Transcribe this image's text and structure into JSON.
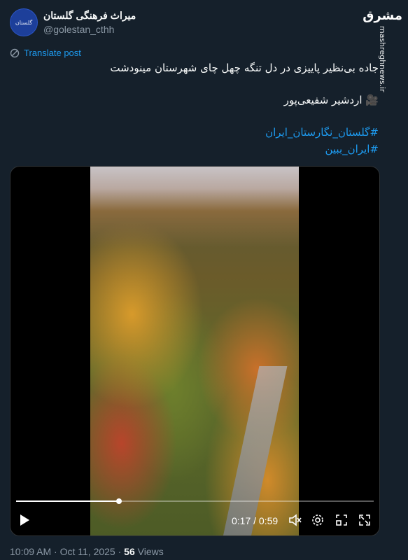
{
  "account": {
    "display_name": "میراث فرهنگی گلستان",
    "handle": "@golestan_cthh",
    "avatar_text": "گلستان"
  },
  "watermark": {
    "logo": "مشرق",
    "site": "mashreghnews.ir"
  },
  "translate_label": "Translate post",
  "tweet": {
    "line1": "جاده بی‌نظیر پاییزی در دل تنگه چهل چای شهرستان مینودشت",
    "credit_icon": "🎥",
    "credit": "اردشیر شفیعی‌پور",
    "hashtag1": "#گلستان_نگارستان_ایران",
    "hashtag2": "#ایران_ببین"
  },
  "video": {
    "current_time": "0:17",
    "duration": "0:59",
    "time_display": "0:17 / 0:59",
    "progress": 0.288
  },
  "footer": {
    "timestamp": "10:09 AM · Oct 11, 2025 · ",
    "views_count": "56",
    "views_label": " Views"
  },
  "colors": {
    "link": "#1d9bf0",
    "background": "#15202b"
  },
  "icons": [
    "translate-icon",
    "play-icon",
    "volume-muted-icon",
    "settings-icon",
    "picture-in-picture-icon",
    "fullscreen-icon"
  ]
}
